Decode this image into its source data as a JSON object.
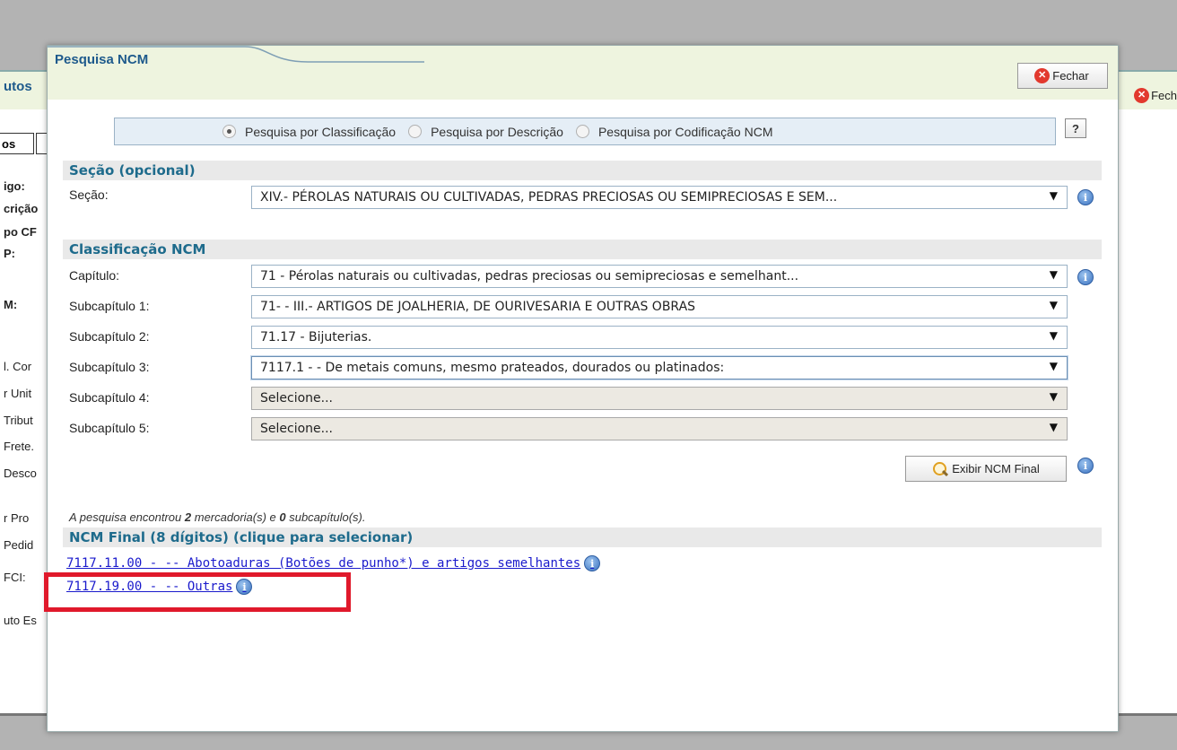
{
  "background": {
    "title_fragment": "utos",
    "close_label": "Fech",
    "tab_label": "os",
    "labels": [
      "igo:",
      "crição",
      "po CF",
      "P:",
      "M:",
      "l. Cor",
      "r Unit",
      "Tribut",
      "Frete.",
      "Desco",
      "r Pro",
      "Pedid",
      "FCI:",
      "uto Es"
    ]
  },
  "modal": {
    "title": "Pesquisa NCM",
    "close_label": "Fechar",
    "search_options": [
      {
        "label": "Pesquisa por Classificação",
        "checked": true
      },
      {
        "label": "Pesquisa por Descrição",
        "checked": false
      },
      {
        "label": "Pesquisa por Codificação NCM",
        "checked": false
      }
    ],
    "help_label": "?",
    "secao": {
      "heading": "Seção (opcional)",
      "label": "Seção:",
      "value": "XIV.- PÉROLAS NATURAIS OU CULTIVADAS, PEDRAS PRECIOSAS OU SEMIPRECIOSAS E SEM..."
    },
    "classificacao": {
      "heading": "Classificação NCM",
      "rows": [
        {
          "label": "Capítulo:",
          "value": "71 - Pérolas naturais ou cultivadas, pedras preciosas ou semipreciosas e semelhant..."
        },
        {
          "label": "Subcapítulo 1:",
          "value": "71- - III.- ARTIGOS DE JOALHERIA, DE OURIVESARIA E OUTRAS OBRAS"
        },
        {
          "label": "Subcapítulo 2:",
          "value": "71.17 - Bijuterias."
        },
        {
          "label": "Subcapítulo 3:",
          "value": "7117.1 - - De metais comuns, mesmo prateados, dourados ou platinados:"
        },
        {
          "label": "Subcapítulo 4:",
          "value": "Selecione..."
        },
        {
          "label": "Subcapítulo 5:",
          "value": "Selecione..."
        }
      ]
    },
    "exibir_button": "Exibir NCM Final",
    "result": {
      "prefix": "A pesquisa encontrou ",
      "count_merc": "2",
      "middle": " mercadoria(s) e ",
      "count_sub": "0",
      "suffix": " subcapítulo(s)."
    },
    "final": {
      "heading": "NCM Final (8 dígitos) (clique para selecionar)",
      "items": [
        "7117.11.00 - -- Abotoaduras (Botões de punho*) e artigos semelhantes",
        "7117.19.00 - -- Outras"
      ]
    },
    "icons": {
      "info": "i",
      "close": "x",
      "caret": "▼"
    }
  }
}
